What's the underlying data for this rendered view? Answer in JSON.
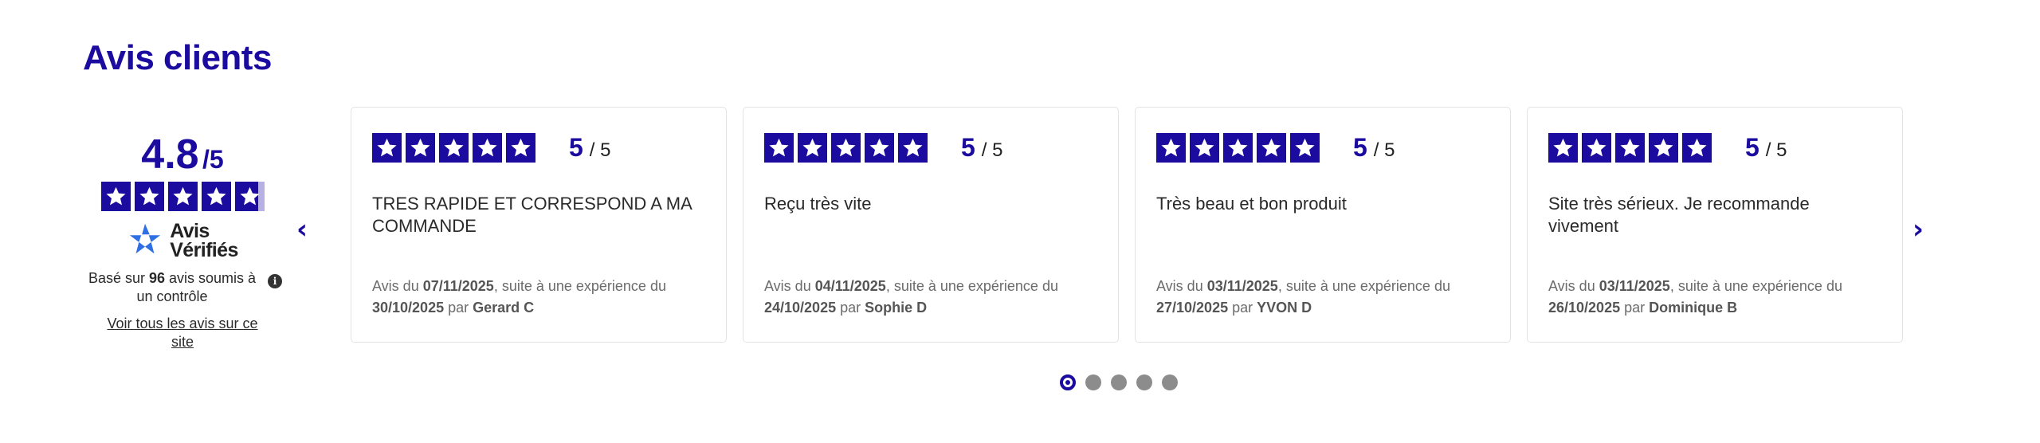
{
  "section_title": "Avis clients",
  "summary": {
    "score": "4.8",
    "score_max": "/5",
    "rating_value": 4.8,
    "brand_line1": "Avis",
    "brand_line2": "Vérifiés",
    "based_prefix": "Basé sur ",
    "based_count": "96",
    "based_suffix": " avis soumis à un contrôle",
    "see_all_label": "Voir tous les avis sur ce site"
  },
  "nav": {
    "prev_label": "‹",
    "next_label": "›"
  },
  "reviews": [
    {
      "rating": "5",
      "rating_max": "/ 5",
      "text": "TRES RAPIDE ET CORRESPOND A MA COMMANDE",
      "meta_prefix": "Avis du ",
      "review_date": "07/11/2025",
      "meta_middle": ", suite à une expérience du ",
      "experience_date": "30/10/2025",
      "meta_by": " par ",
      "author": "Gerard C"
    },
    {
      "rating": "5",
      "rating_max": "/ 5",
      "text": "Reçu très vite",
      "meta_prefix": "Avis du ",
      "review_date": "04/11/2025",
      "meta_middle": ", suite à une expérience du ",
      "experience_date": "24/10/2025",
      "meta_by": " par ",
      "author": "Sophie D"
    },
    {
      "rating": "5",
      "rating_max": "/ 5",
      "text": "Très beau et bon produit",
      "meta_prefix": "Avis du ",
      "review_date": "03/11/2025",
      "meta_middle": ", suite à une expérience du ",
      "experience_date": "27/10/2025",
      "meta_by": " par ",
      "author": "YVON D"
    },
    {
      "rating": "5",
      "rating_max": "/ 5",
      "text": "Site très sérieux. Je recommande vivement",
      "meta_prefix": "Avis du ",
      "review_date": "03/11/2025",
      "meta_middle": ", suite à une expérience du ",
      "experience_date": "26/10/2025",
      "meta_by": " par ",
      "author": "Dominique B"
    }
  ],
  "pagination": {
    "count": 5,
    "active_index": 0
  },
  "colors": {
    "accent": "#1b0b9e",
    "star_empty": "#b7b0e3",
    "dot_inactive": "#8c8c8c"
  },
  "icons": {
    "info": "info-icon",
    "prev": "chevron-left-icon",
    "next": "chevron-right-icon",
    "brand": "avis-verifies-logo"
  }
}
